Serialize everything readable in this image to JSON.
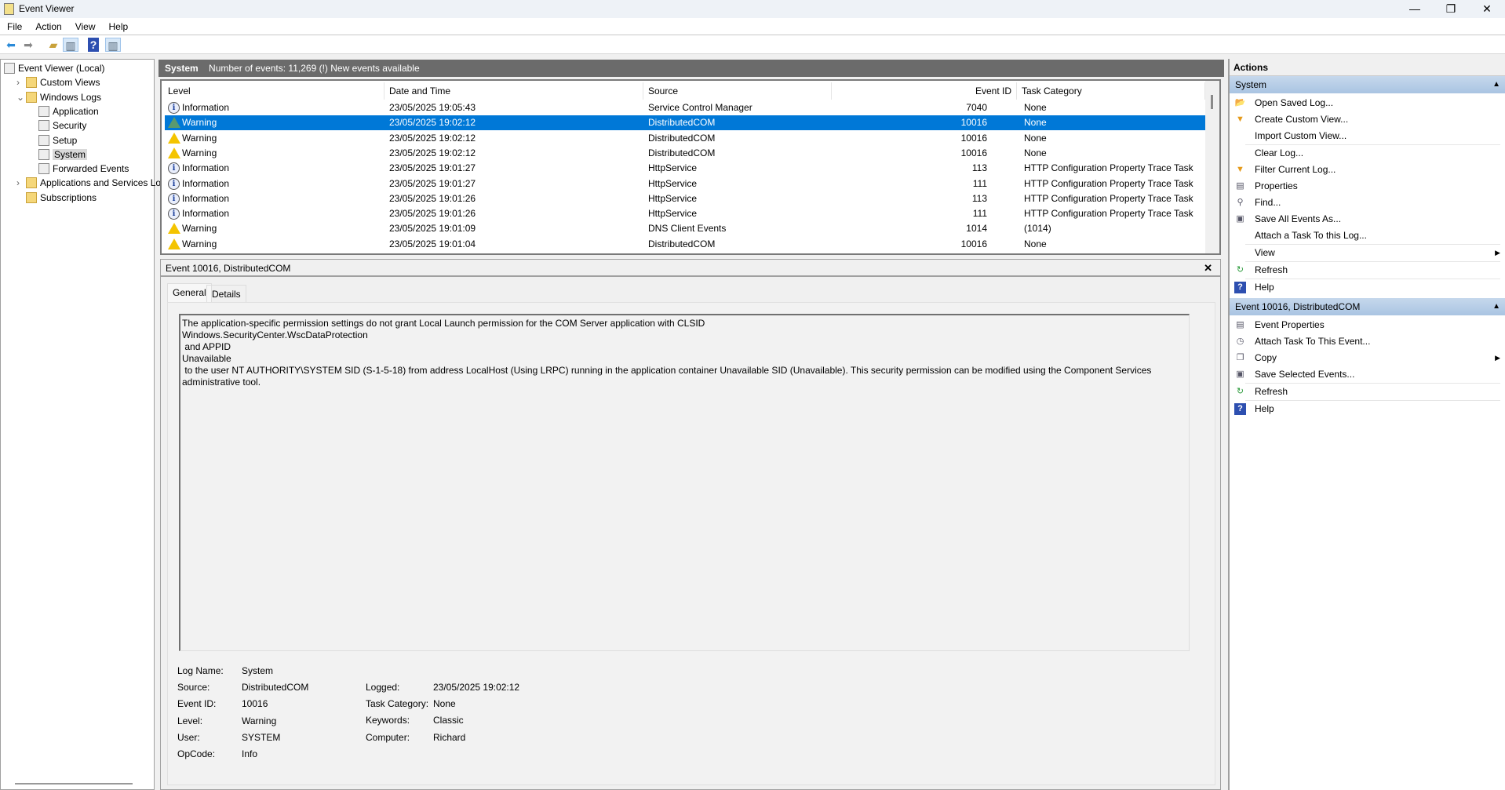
{
  "window": {
    "title": "Event Viewer",
    "minimize": "—",
    "maximize": "❐",
    "close": "✕"
  },
  "menu": [
    "File",
    "Action",
    "View",
    "Help"
  ],
  "toolbar": {
    "icons": [
      "back-icon",
      "forward-icon",
      "up-folder-icon",
      "show-hide-tree-icon",
      "help-icon",
      "show-hide-action-icon"
    ]
  },
  "tree": [
    {
      "label": "Event Viewer (Local)",
      "level": 0,
      "expander": ""
    },
    {
      "label": "Custom Views",
      "level": 1,
      "expander": "›"
    },
    {
      "label": "Windows Logs",
      "level": 1,
      "expander": "⌄"
    },
    {
      "label": "Application",
      "level": 2,
      "expander": ""
    },
    {
      "label": "Security",
      "level": 2,
      "expander": ""
    },
    {
      "label": "Setup",
      "level": 2,
      "expander": ""
    },
    {
      "label": "System",
      "level": 2,
      "expander": "",
      "selected": true
    },
    {
      "label": "Forwarded Events",
      "level": 2,
      "expander": ""
    },
    {
      "label": "Applications and Services Lo",
      "level": 1,
      "expander": "›"
    },
    {
      "label": "Subscriptions",
      "level": 1,
      "expander": ""
    }
  ],
  "center": {
    "log_name": "System",
    "summary": "Number of events: 11,269 (!) New events available"
  },
  "table": {
    "columns": [
      "Level",
      "Date and Time",
      "Source",
      "Event ID",
      "Task Category"
    ],
    "rows": [
      {
        "level": "Information",
        "date": "23/05/2025 19:05:43",
        "source": "Service Control Manager",
        "id": "7040",
        "category": "None"
      },
      {
        "level": "Warning",
        "date": "23/05/2025 19:02:12",
        "source": "DistributedCOM",
        "id": "10016",
        "category": "None",
        "selected": true
      },
      {
        "level": "Warning",
        "date": "23/05/2025 19:02:12",
        "source": "DistributedCOM",
        "id": "10016",
        "category": "None"
      },
      {
        "level": "Warning",
        "date": "23/05/2025 19:02:12",
        "source": "DistributedCOM",
        "id": "10016",
        "category": "None"
      },
      {
        "level": "Information",
        "date": "23/05/2025 19:01:27",
        "source": "HttpService",
        "id": "113",
        "category": "HTTP Configuration Property Trace Task"
      },
      {
        "level": "Information",
        "date": "23/05/2025 19:01:27",
        "source": "HttpService",
        "id": "111",
        "category": "HTTP Configuration Property Trace Task"
      },
      {
        "level": "Information",
        "date": "23/05/2025 19:01:26",
        "source": "HttpService",
        "id": "113",
        "category": "HTTP Configuration Property Trace Task"
      },
      {
        "level": "Information",
        "date": "23/05/2025 19:01:26",
        "source": "HttpService",
        "id": "111",
        "category": "HTTP Configuration Property Trace Task"
      },
      {
        "level": "Warning",
        "date": "23/05/2025 19:01:09",
        "source": "DNS Client Events",
        "id": "1014",
        "category": "(1014)"
      },
      {
        "level": "Warning",
        "date": "23/05/2025 19:01:04",
        "source": "DistributedCOM",
        "id": "10016",
        "category": "None"
      }
    ]
  },
  "detail": {
    "title": "Event 10016, DistributedCOM",
    "close": "✕",
    "tabs": [
      "General",
      "Details"
    ],
    "message": "The application-specific permission settings do not grant Local Launch permission for the COM Server application with CLSID\nWindows.SecurityCenter.WscDataProtection\n and APPID\nUnavailable\n to the user NT AUTHORITY\\SYSTEM SID (S-1-5-18) from address LocalHost (Using LRPC) running in the application container Unavailable SID (Unavailable). This security permission can be modified using the Component Services\nadministrative tool.",
    "fields_left": [
      {
        "label": "Log Name:",
        "value": "System"
      },
      {
        "label": "Source:",
        "value": "DistributedCOM"
      },
      {
        "label": "Event ID:",
        "value": "10016"
      },
      {
        "label": "Level:",
        "value": "Warning"
      },
      {
        "label": "User:",
        "value": "SYSTEM"
      },
      {
        "label": "OpCode:",
        "value": "Info"
      }
    ],
    "fields_right": [
      {
        "label": "Logged:",
        "value": "23/05/2025 19:02:12"
      },
      {
        "label": "Task Category:",
        "value": "None"
      },
      {
        "label": "Keywords:",
        "value": "Classic"
      },
      {
        "label": "Computer:",
        "value": "Richard"
      }
    ]
  },
  "actions": {
    "title": "Actions",
    "sections": [
      {
        "title": "System",
        "items": [
          {
            "label": "Open Saved Log...",
            "icon": "open-folder-icon",
            "glyph": "📂"
          },
          {
            "label": "Create Custom View...",
            "icon": "filter-icon",
            "glyph": "▼"
          },
          {
            "label": "Import Custom View...",
            "icon": "",
            "glyph": "",
            "sep": true
          },
          {
            "label": "Clear Log...",
            "icon": "",
            "glyph": ""
          },
          {
            "label": "Filter Current Log...",
            "icon": "filter-icon",
            "glyph": "▼"
          },
          {
            "label": "Properties",
            "icon": "properties-icon",
            "glyph": "▤"
          },
          {
            "label": "Find...",
            "icon": "binoculars-icon",
            "glyph": "⚲"
          },
          {
            "label": "Save All Events As...",
            "icon": "save-icon",
            "glyph": "▣"
          },
          {
            "label": "Attach a Task To this Log...",
            "icon": "",
            "glyph": "",
            "sep": true
          },
          {
            "label": "View",
            "icon": "",
            "glyph": "",
            "submenu": "▶",
            "sep": true
          },
          {
            "label": "Refresh",
            "icon": "refresh-icon",
            "glyph": "↻",
            "sep": true
          },
          {
            "label": "Help",
            "icon": "help-icon",
            "glyph": "?"
          }
        ]
      },
      {
        "title": "Event 10016, DistributedCOM",
        "items": [
          {
            "label": "Event Properties",
            "icon": "properties-icon",
            "glyph": "▤"
          },
          {
            "label": "Attach Task To This Event...",
            "icon": "task-clock-icon",
            "glyph": "◷"
          },
          {
            "label": "Copy",
            "icon": "copy-icon",
            "glyph": "❐",
            "submenu": "▶"
          },
          {
            "label": "Save Selected Events...",
            "icon": "save-icon",
            "glyph": "▣",
            "sep": true
          },
          {
            "label": "Refresh",
            "icon": "refresh-icon",
            "glyph": "↻",
            "sep": true
          },
          {
            "label": "Help",
            "icon": "help-icon",
            "glyph": "?"
          }
        ]
      }
    ]
  },
  "colors": {
    "selection": "#0078d7",
    "header_bar": "#6b6b6b",
    "section": "#b4cde6"
  }
}
